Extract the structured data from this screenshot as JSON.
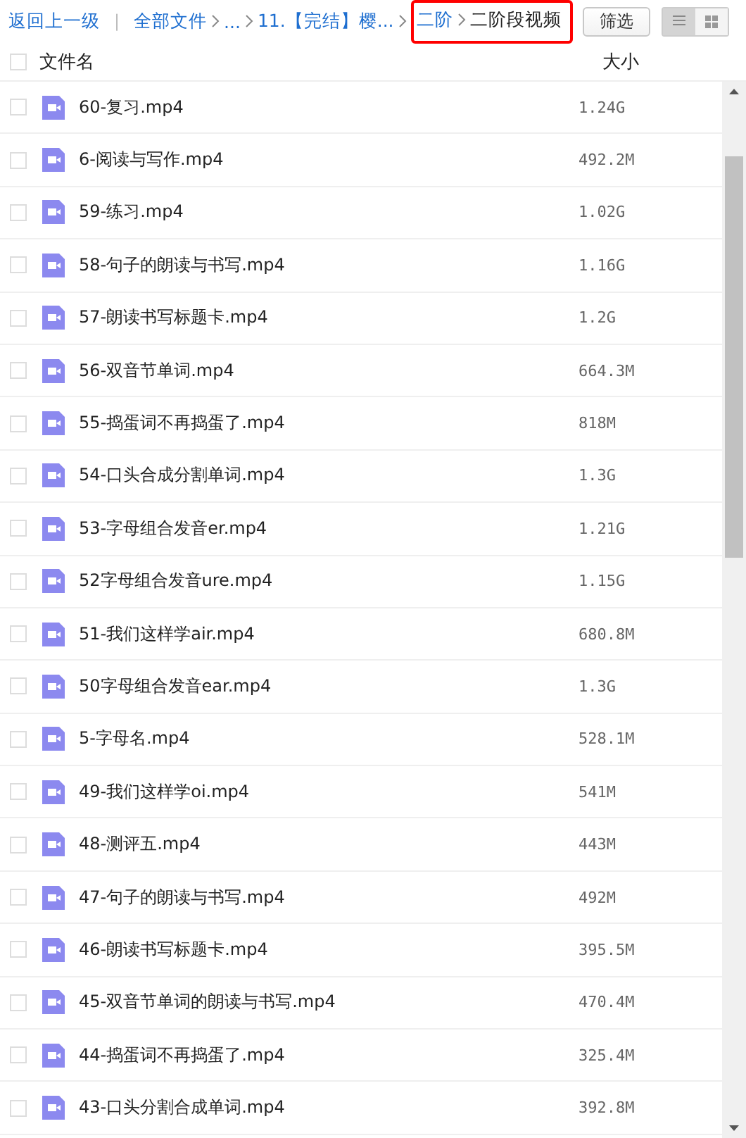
{
  "breadcrumb": {
    "back": "返回上一级",
    "divider": "|",
    "items": [
      {
        "label": "全部文件",
        "current": false
      },
      {
        "label": "...",
        "current": false
      },
      {
        "label": "11.【完结】樱...",
        "current": false
      }
    ],
    "red_box_items": [
      {
        "label": "二阶",
        "current": false
      },
      {
        "label": "二阶段视频",
        "current": true
      }
    ]
  },
  "filter_button": "筛选",
  "view_toggle": [
    {
      "kind": "list",
      "selected": true
    },
    {
      "kind": "grid",
      "selected": false
    }
  ],
  "table": {
    "columns": [
      "文件名",
      "大小"
    ],
    "select_all_checked": false,
    "rows": [
      {
        "name": "60-复习.mp4",
        "size": "1.24G",
        "checked": false
      },
      {
        "name": "6-阅读与写作.mp4",
        "size": "492.2M",
        "checked": false
      },
      {
        "name": "59-练习.mp4",
        "size": "1.02G",
        "checked": false
      },
      {
        "name": "58-句子的朗读与书写.mp4",
        "size": "1.16G",
        "checked": false
      },
      {
        "name": "57-朗读书写标题卡.mp4",
        "size": "1.2G",
        "checked": false
      },
      {
        "name": "56-双音节单词.mp4",
        "size": "664.3M",
        "checked": false
      },
      {
        "name": "55-捣蛋词不再捣蛋了.mp4",
        "size": "818M",
        "checked": false
      },
      {
        "name": "54-口头合成分割单词.mp4",
        "size": "1.3G",
        "checked": false
      },
      {
        "name": "53-字母组合发音er.mp4",
        "size": "1.21G",
        "checked": false
      },
      {
        "name": "52字母组合发音ure.mp4",
        "size": "1.15G",
        "checked": false
      },
      {
        "name": "51-我们这样学air.mp4",
        "size": "680.8M",
        "checked": false
      },
      {
        "name": "50字母组合发音ear.mp4",
        "size": "1.3G",
        "checked": false
      },
      {
        "name": "5-字母名.mp4",
        "size": "528.1M",
        "checked": false
      },
      {
        "name": "49-我们这样学oi.mp4",
        "size": "541M",
        "checked": false
      },
      {
        "name": "48-测评五.mp4",
        "size": "443M",
        "checked": false
      },
      {
        "name": "47-句子的朗读与书写.mp4",
        "size": "492M",
        "checked": false
      },
      {
        "name": "46-朗读书写标题卡.mp4",
        "size": "395.5M",
        "checked": false
      },
      {
        "name": "45-双音节单词的朗读与书写.mp4",
        "size": "470.4M",
        "checked": false
      },
      {
        "name": "44-捣蛋词不再捣蛋了.mp4",
        "size": "325.4M",
        "checked": false
      },
      {
        "name": "43-口头分割合成单词.mp4",
        "size": "392.8M",
        "checked": false
      }
    ]
  }
}
